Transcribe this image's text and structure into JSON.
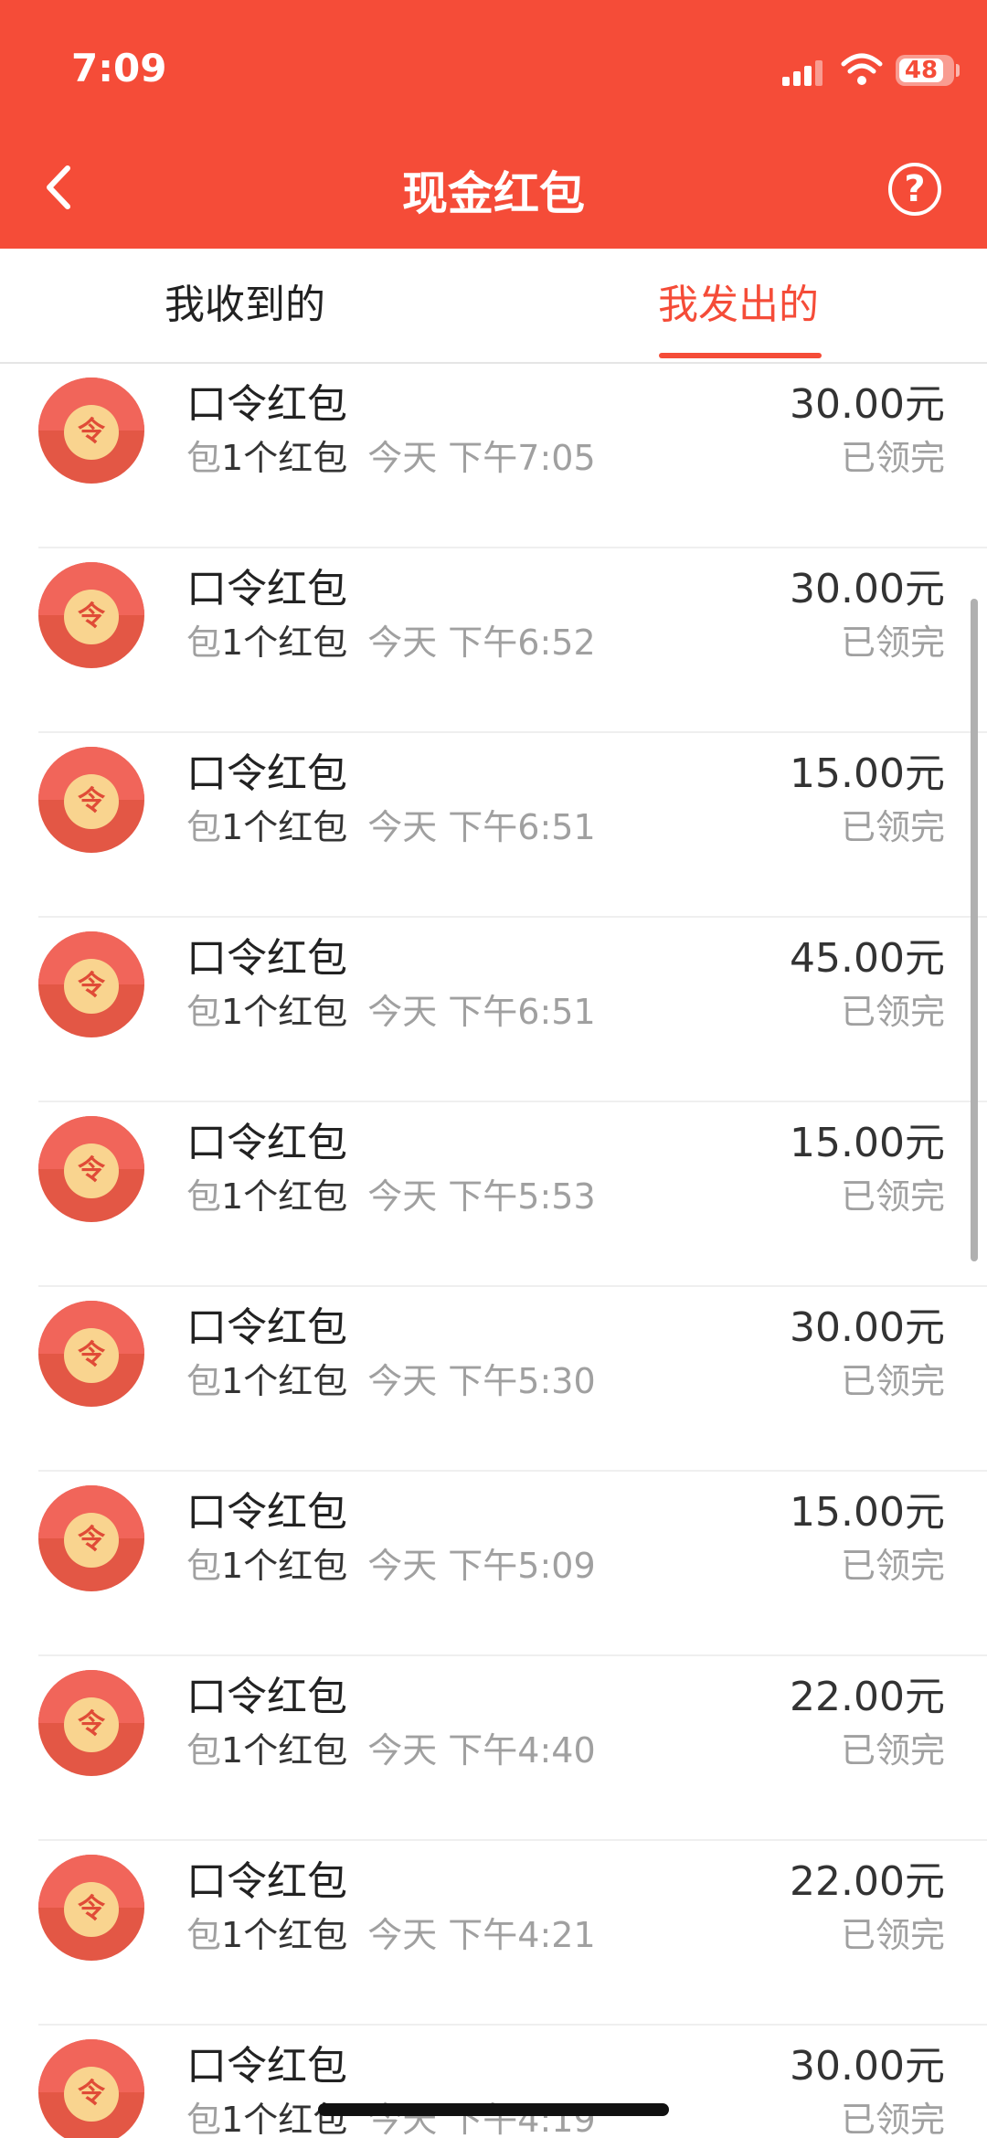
{
  "status_bar": {
    "time": "7:09",
    "battery": "48"
  },
  "header": {
    "title": "现金红包",
    "back_icon": "chevron-left-icon",
    "help_icon": "question-circle-icon",
    "help_glyph": "?"
  },
  "tabs": [
    {
      "label": "我收到的",
      "active": false
    },
    {
      "label": "我发出的",
      "active": true
    }
  ],
  "accent_color": "#f54c38",
  "items": [
    {
      "title": "口令红包",
      "prefix": "包",
      "count": "1个红包",
      "time": "今天 下午7:05",
      "amount": "30.00元",
      "status": "已领完",
      "icon_glyph": "令"
    },
    {
      "title": "口令红包",
      "prefix": "包",
      "count": "1个红包",
      "time": "今天 下午6:52",
      "amount": "30.00元",
      "status": "已领完",
      "icon_glyph": "令"
    },
    {
      "title": "口令红包",
      "prefix": "包",
      "count": "1个红包",
      "time": "今天 下午6:51",
      "amount": "15.00元",
      "status": "已领完",
      "icon_glyph": "令"
    },
    {
      "title": "口令红包",
      "prefix": "包",
      "count": "1个红包",
      "time": "今天 下午6:51",
      "amount": "45.00元",
      "status": "已领完",
      "icon_glyph": "令"
    },
    {
      "title": "口令红包",
      "prefix": "包",
      "count": "1个红包",
      "time": "今天 下午5:53",
      "amount": "15.00元",
      "status": "已领完",
      "icon_glyph": "令"
    },
    {
      "title": "口令红包",
      "prefix": "包",
      "count": "1个红包",
      "time": "今天 下午5:30",
      "amount": "30.00元",
      "status": "已领完",
      "icon_glyph": "令"
    },
    {
      "title": "口令红包",
      "prefix": "包",
      "count": "1个红包",
      "time": "今天 下午5:09",
      "amount": "15.00元",
      "status": "已领完",
      "icon_glyph": "令"
    },
    {
      "title": "口令红包",
      "prefix": "包",
      "count": "1个红包",
      "time": "今天 下午4:40",
      "amount": "22.00元",
      "status": "已领完",
      "icon_glyph": "令"
    },
    {
      "title": "口令红包",
      "prefix": "包",
      "count": "1个红包",
      "time": "今天 下午4:21",
      "amount": "22.00元",
      "status": "已领完",
      "icon_glyph": "令"
    },
    {
      "title": "口令红包",
      "prefix": "包",
      "count": "1个红包",
      "time": "今天 下午4:19",
      "amount": "30.00元",
      "status": "已领完",
      "icon_glyph": "令"
    }
  ]
}
